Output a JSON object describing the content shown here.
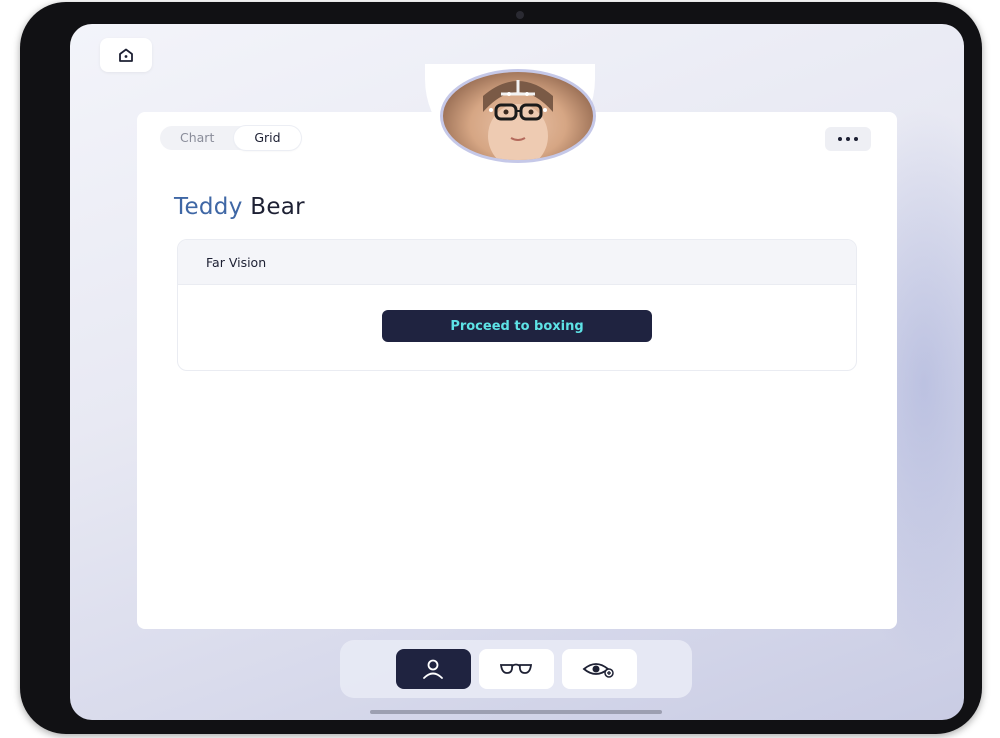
{
  "segmented_control": {
    "options": [
      {
        "label": "Chart",
        "active": false
      },
      {
        "label": "Grid",
        "active": true
      }
    ]
  },
  "profile": {
    "first_name": "Teddy",
    "last_name": "Bear",
    "avatar_icon": "patient-photo"
  },
  "far_vision": {
    "header": "Far Vision",
    "action_label": "Proceed to boxing"
  },
  "toolbar": {
    "home_icon": "home-icon",
    "more_icon": "ellipsis-icon"
  },
  "bottom_nav": {
    "items": [
      {
        "icon": "person-icon",
        "active": true
      },
      {
        "icon": "glasses-icon",
        "active": false
      },
      {
        "icon": "eye-icon",
        "active": false
      }
    ]
  },
  "colors": {
    "accent": "#1f2340",
    "button_text": "#5ee3e6",
    "first_name": "#3f67a5"
  }
}
